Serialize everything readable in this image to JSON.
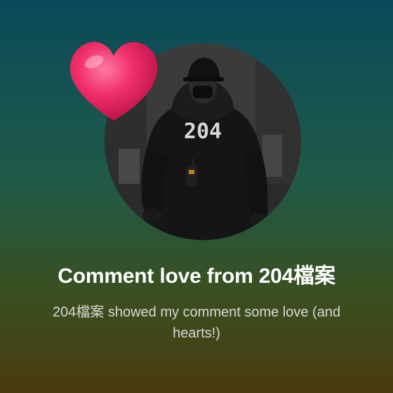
{
  "card": {
    "title": "Comment love from 204檔案",
    "subtitle": "204檔案 showed my comment some love (and hearts!)",
    "avatar_shirt_text": "204"
  },
  "icons": {
    "heart": "heart-icon",
    "avatar": "avatar"
  },
  "colors": {
    "heart": "#f0306a",
    "title": "#ffffff",
    "subtitle": "#d8d8d8"
  }
}
